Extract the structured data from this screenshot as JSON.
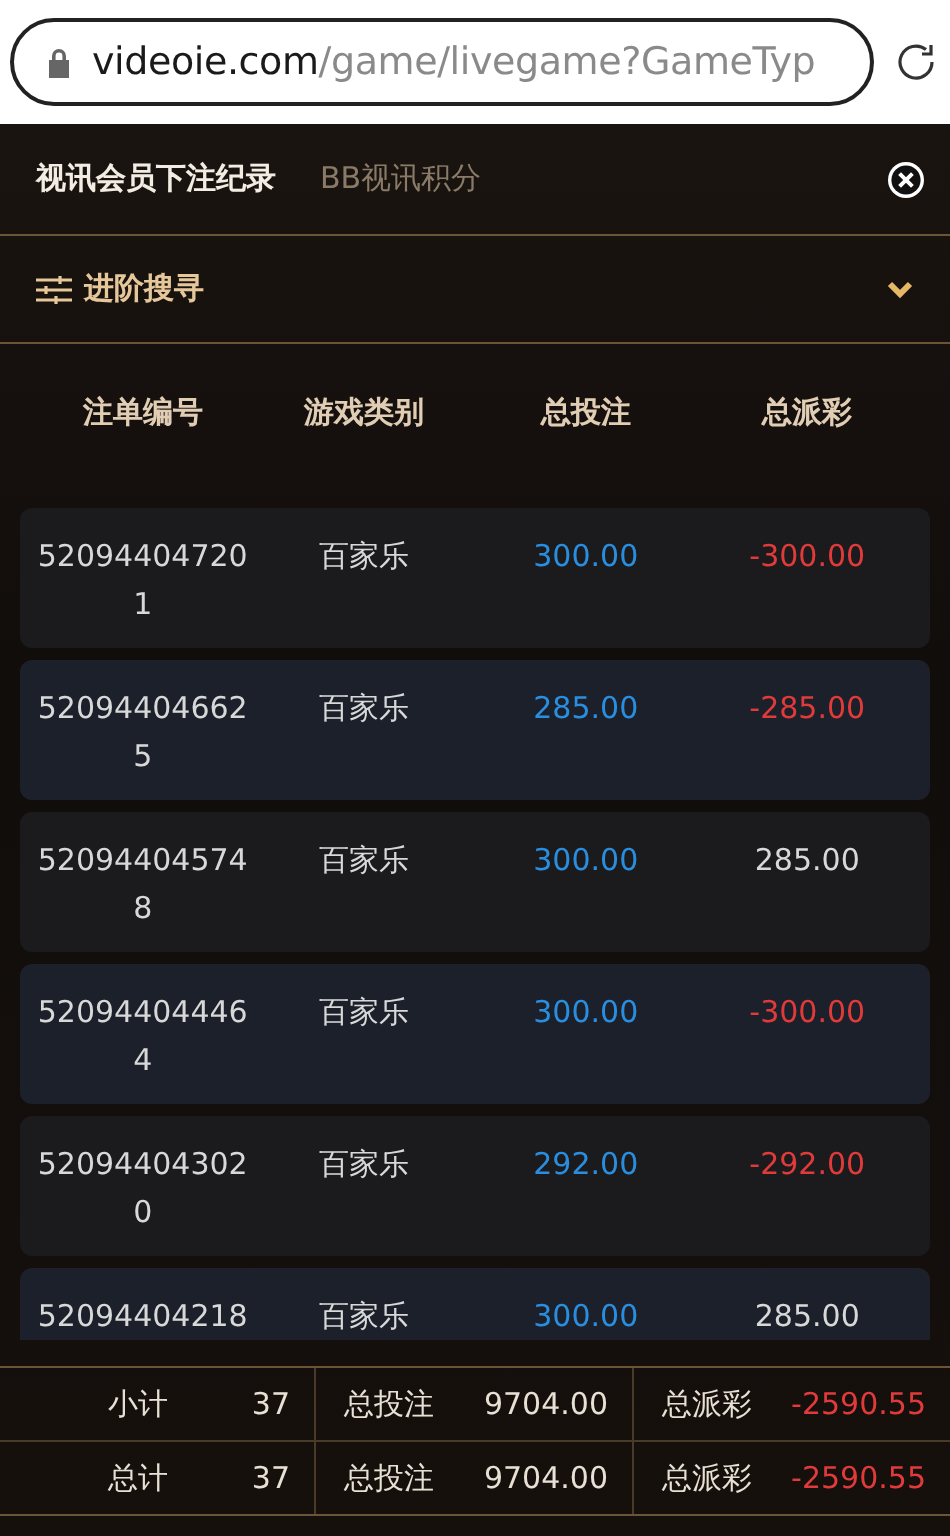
{
  "address_bar": {
    "domain": "videoie.com",
    "path": "/game/livegame?GameTyp"
  },
  "tabs": [
    {
      "label": "视讯会员下注纪录",
      "selected": true
    },
    {
      "label": "BB视讯积分",
      "selected": false
    }
  ],
  "advanced_search": {
    "label": "进阶搜寻",
    "expanded": false
  },
  "table": {
    "columns": [
      "注单编号",
      "游戏类别",
      "总投注",
      "总派彩"
    ],
    "rows": [
      {
        "id": "520944047201",
        "game": "百家乐",
        "bet": "300.00",
        "payout": "-300.00",
        "negative": true
      },
      {
        "id": "520944046625",
        "game": "百家乐",
        "bet": "285.00",
        "payout": "-285.00",
        "negative": true
      },
      {
        "id": "520944045748",
        "game": "百家乐",
        "bet": "300.00",
        "payout": "285.00",
        "negative": false
      },
      {
        "id": "520944044464",
        "game": "百家乐",
        "bet": "300.00",
        "payout": "-300.00",
        "negative": true
      },
      {
        "id": "520944043020",
        "game": "百家乐",
        "bet": "292.00",
        "payout": "-292.00",
        "negative": true
      },
      {
        "id": "52094404218",
        "game": "百家乐",
        "bet": "300.00",
        "payout": "285.00",
        "negative": false
      }
    ]
  },
  "summary": [
    {
      "label": "小计",
      "count": "37",
      "bet_label": "总投注",
      "bet": "9704.00",
      "payout_label": "总派彩",
      "payout": "-2590.55",
      "negative": true
    },
    {
      "label": "总计",
      "count": "37",
      "bet_label": "总投注",
      "bet": "9704.00",
      "payout_label": "总派彩",
      "payout": "-2590.55",
      "negative": true
    }
  ]
}
